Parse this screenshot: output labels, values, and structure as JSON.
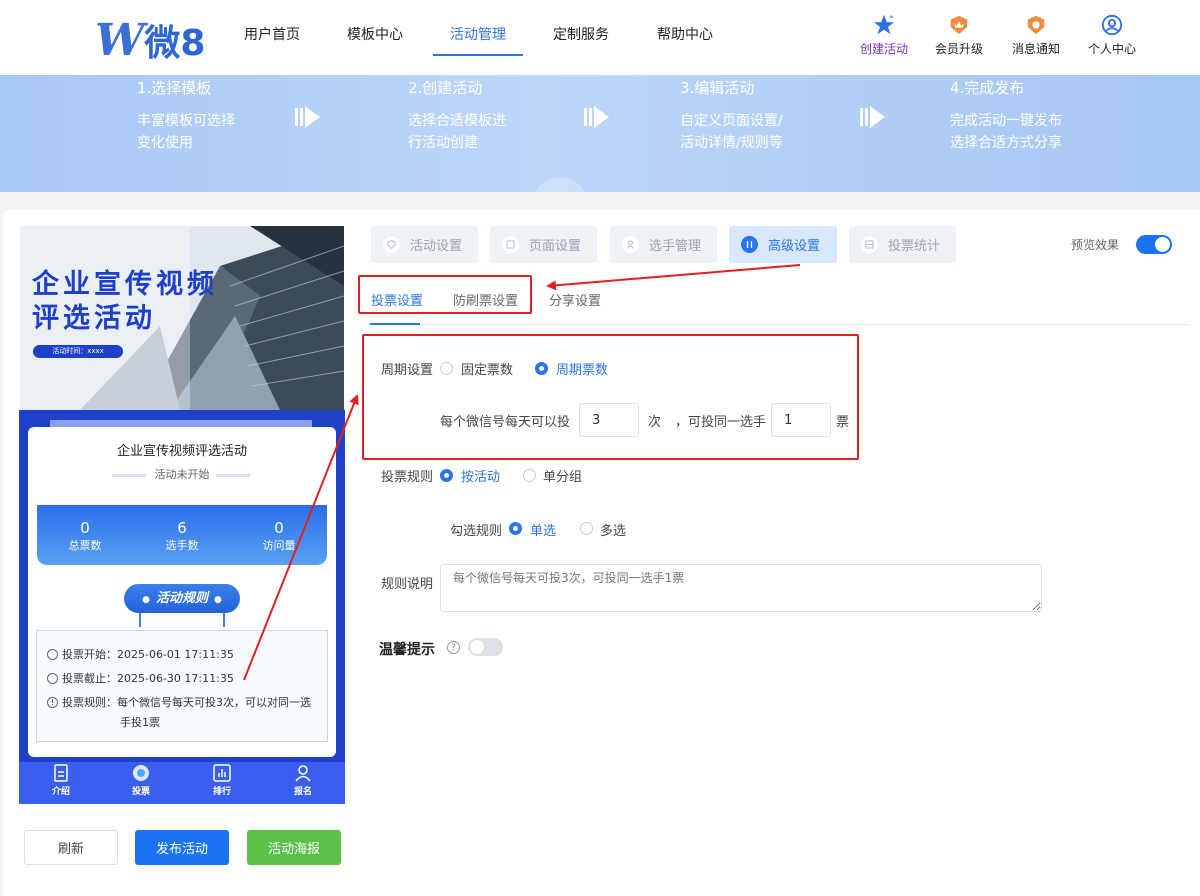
{
  "header": {
    "logo_glyph": "W",
    "logo_text": "微8",
    "nav": [
      "用户首页",
      "模板中心",
      "活动管理",
      "定制服务",
      "帮助中心"
    ],
    "active_nav": "活动管理",
    "utils": [
      "创建活动",
      "会员升级",
      "消息通知",
      "个人中心"
    ]
  },
  "banner": {
    "steps": [
      {
        "title": "1.选择模板",
        "desc1": "丰富模板可选择",
        "desc2": "变化使用"
      },
      {
        "title": "2.创建活动",
        "desc1": "选择合适模板进",
        "desc2": "行活动创建"
      },
      {
        "title": "3.编辑活动",
        "desc1": "自定义页面设置/",
        "desc2": "活动详情/规则等"
      },
      {
        "title": "4.完成发布",
        "desc1": "完成活动一键发布",
        "desc2": "选择合适方式分享"
      }
    ]
  },
  "preview": {
    "poster_title_1": "企业宣传视频",
    "poster_title_2": "评选活动",
    "poster_time": "活动时间：xxxx",
    "card_title": "企业宣传视频评选活动",
    "card_status": "活动未开始",
    "stats": [
      {
        "value": "0",
        "label": "总票数"
      },
      {
        "value": "6",
        "label": "选手数"
      },
      {
        "value": "0",
        "label": "访问量"
      }
    ],
    "rules_button": "活动规则",
    "info": [
      "投票开始：2025-06-01 17:11:35",
      "投票截止：2025-06-30 17:11:35",
      "投票规则：每个微信号每天可投3次，可以对同一选",
      "手投1票"
    ],
    "bottom_nav": [
      "介绍",
      "投票",
      "排行",
      "报名"
    ]
  },
  "actions": {
    "refresh": "刷新",
    "publish": "发布活动",
    "poster": "活动海报"
  },
  "tabs": [
    "活动设置",
    "页面设置",
    "选手管理",
    "高级设置",
    "投票统计"
  ],
  "active_tab": "高级设置",
  "preview_toggle_label": "预览效果",
  "preview_toggle_on": true,
  "subtabs": [
    "投票设置",
    "防刷票设置",
    "分享设置"
  ],
  "active_subtab": "投票设置",
  "form": {
    "cycle_label": "周期设置",
    "cycle_options": [
      "固定票数",
      "周期票数"
    ],
    "cycle_selected": "周期票数",
    "per_day_prefix": "每个微信号每天可以投",
    "per_day_value": "3",
    "per_day_unit": "次",
    "same_player_prefix": "，可投同一选手",
    "same_player_value": "1",
    "same_player_unit": "票",
    "rule_label": "投票规则",
    "rule_options": [
      "按活动",
      "单分组"
    ],
    "rule_selected": "按活动",
    "check_label": "勾选规则",
    "check_options": [
      "单选",
      "多选"
    ],
    "check_selected": "单选",
    "desc_label": "规则说明",
    "desc_placeholder": "每个微信号每天可投3次，可投同一选手1票",
    "tip_label": "温馨提示",
    "tip_icon": "?",
    "tip_on": false
  },
  "colors": {
    "accent": "#2a75e8",
    "annotation": "#e02020",
    "publish": "#1a73f0",
    "poster": "#5cc14a"
  }
}
